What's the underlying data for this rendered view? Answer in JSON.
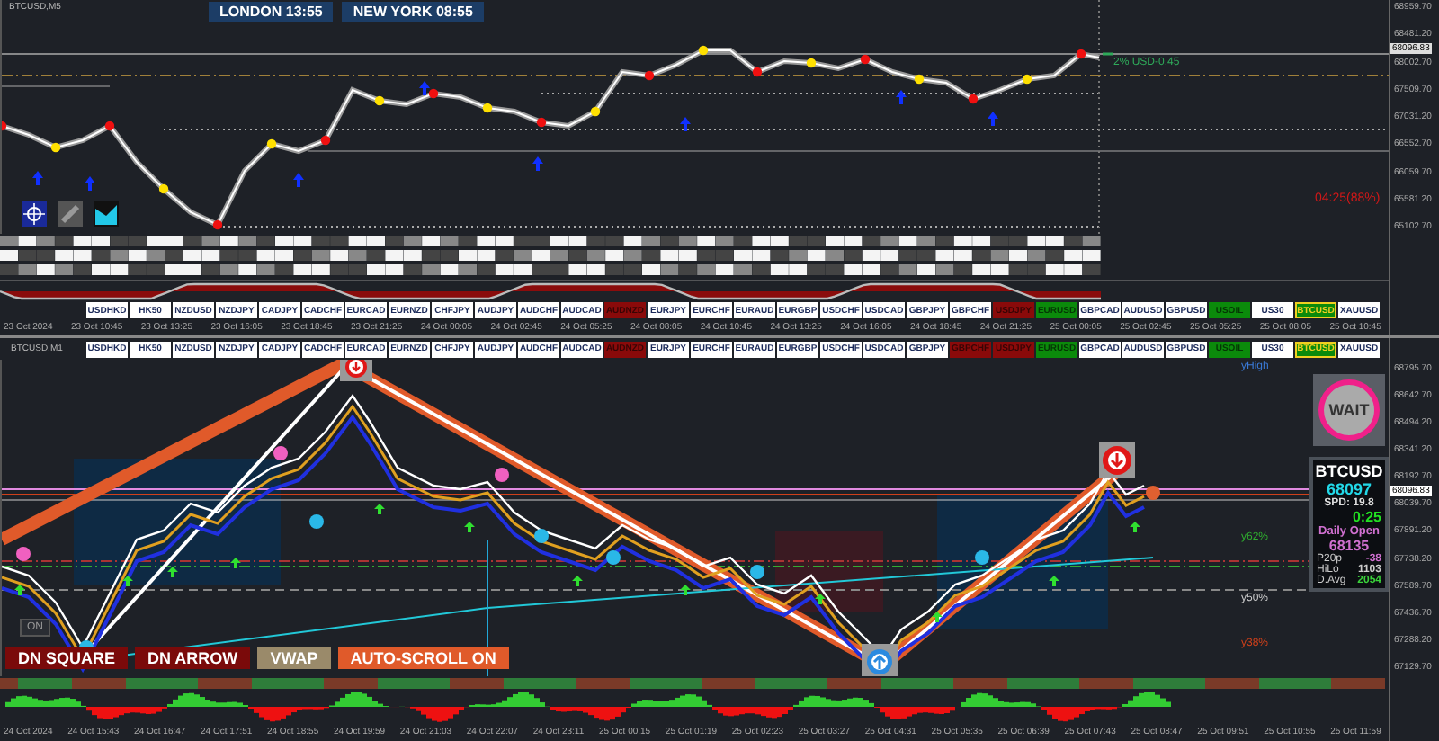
{
  "top_chart": {
    "title": "BTCUSD,M5",
    "sessions": [
      {
        "label": "LONDON 13:55"
      },
      {
        "label": "NEW YORK 08:55"
      }
    ],
    "risk_label": "2% USD-0.45",
    "timer": "04:25(88%)",
    "price_axis": [
      "68959.70",
      "68481.20",
      "68002.70",
      "67509.70",
      "67031.20",
      "66552.70",
      "66059.70",
      "65581.20",
      "65102.70"
    ],
    "current_price": "68096.83",
    "symbols": [
      {
        "label": "USDHKD",
        "color": "#ffffff",
        "selected": false
      },
      {
        "label": "HK50",
        "color": "#ffffff",
        "selected": false
      },
      {
        "label": "NZDUSD",
        "color": "#ffffff",
        "selected": false
      },
      {
        "label": "NZDJPY",
        "color": "#ffffff",
        "selected": false
      },
      {
        "label": "CADJPY",
        "color": "#ffffff",
        "selected": false
      },
      {
        "label": "CADCHF",
        "color": "#ffffff",
        "selected": false
      },
      {
        "label": "EURCAD",
        "color": "#ffffff",
        "selected": false
      },
      {
        "label": "EURNZD",
        "color": "#ffffff",
        "selected": false
      },
      {
        "label": "CHFJPY",
        "color": "#ffffff",
        "selected": false
      },
      {
        "label": "AUDJPY",
        "color": "#ffffff",
        "selected": false
      },
      {
        "label": "AUDCHF",
        "color": "#ffffff",
        "selected": false
      },
      {
        "label": "AUDCAD",
        "color": "#ffffff",
        "selected": false
      },
      {
        "label": "AUDNZD",
        "color": "#8a0a0a",
        "selected": false
      },
      {
        "label": "EURJPY",
        "color": "#ffffff",
        "selected": false
      },
      {
        "label": "EURCHF",
        "color": "#ffffff",
        "selected": false
      },
      {
        "label": "EURAUD",
        "color": "#ffffff",
        "selected": false
      },
      {
        "label": "EURGBP",
        "color": "#ffffff",
        "selected": false
      },
      {
        "label": "USDCHF",
        "color": "#ffffff",
        "selected": false
      },
      {
        "label": "USDCAD",
        "color": "#ffffff",
        "selected": false
      },
      {
        "label": "GBPJPY",
        "color": "#ffffff",
        "selected": false
      },
      {
        "label": "GBPCHF",
        "color": "#ffffff",
        "selected": false
      },
      {
        "label": "USDJPY",
        "color": "#8a0a0a",
        "selected": false
      },
      {
        "label": "EURUSD",
        "color": "#0b8a0b",
        "selected": false
      },
      {
        "label": "GBPCAD",
        "color": "#ffffff",
        "selected": false
      },
      {
        "label": "AUDUSD",
        "color": "#ffffff",
        "selected": false
      },
      {
        "label": "GBPUSD",
        "color": "#ffffff",
        "selected": false
      },
      {
        "label": "USOIL",
        "color": "#0b8a0b",
        "selected": false
      },
      {
        "label": "US30",
        "color": "#ffffff",
        "selected": false
      },
      {
        "label": "BTCUSD",
        "color": "#0b8a0b",
        "selected": true
      },
      {
        "label": "XAUUSD",
        "color": "#ffffff",
        "selected": false
      }
    ],
    "time_axis": [
      "23 Oct 2024",
      "23 Oct 10:45",
      "23 Oct 13:25",
      "23 Oct 16:05",
      "23 Oct 18:45",
      "23 Oct 21:25",
      "24 Oct 00:05",
      "24 Oct 02:45",
      "24 Oct 05:25",
      "24 Oct 08:05",
      "24 Oct 10:45",
      "24 Oct 13:25",
      "24 Oct 16:05",
      "24 Oct 18:45",
      "24 Oct 21:25",
      "25 Oct 00:05",
      "25 Oct 02:45",
      "25 Oct 05:25",
      "25 Oct 08:05",
      "25 Oct 10:45"
    ]
  },
  "bottom_chart": {
    "title": "BTCUSD,M1",
    "symbols": [
      {
        "label": "USDHKD",
        "color": "#ffffff",
        "selected": false
      },
      {
        "label": "HK50",
        "color": "#ffffff",
        "selected": false
      },
      {
        "label": "NZDUSD",
        "color": "#ffffff",
        "selected": false
      },
      {
        "label": "NZDJPY",
        "color": "#ffffff",
        "selected": false
      },
      {
        "label": "CADJPY",
        "color": "#ffffff",
        "selected": false
      },
      {
        "label": "CADCHF",
        "color": "#ffffff",
        "selected": false
      },
      {
        "label": "EURCAD",
        "color": "#ffffff",
        "selected": false
      },
      {
        "label": "EURNZD",
        "color": "#ffffff",
        "selected": false
      },
      {
        "label": "CHFJPY",
        "color": "#ffffff",
        "selected": false
      },
      {
        "label": "AUDJPY",
        "color": "#ffffff",
        "selected": false
      },
      {
        "label": "AUDCHF",
        "color": "#ffffff",
        "selected": false
      },
      {
        "label": "AUDCAD",
        "color": "#ffffff",
        "selected": false
      },
      {
        "label": "AUDNZD",
        "color": "#8a0a0a",
        "selected": false
      },
      {
        "label": "EURJPY",
        "color": "#ffffff",
        "selected": false
      },
      {
        "label": "EURCHF",
        "color": "#ffffff",
        "selected": false
      },
      {
        "label": "EURAUD",
        "color": "#ffffff",
        "selected": false
      },
      {
        "label": "EURGBP",
        "color": "#ffffff",
        "selected": false
      },
      {
        "label": "USDCHF",
        "color": "#ffffff",
        "selected": false
      },
      {
        "label": "USDCAD",
        "color": "#ffffff",
        "selected": false
      },
      {
        "label": "GBPJPY",
        "color": "#ffffff",
        "selected": false
      },
      {
        "label": "GBPCHF",
        "color": "#8a0a0a",
        "selected": false
      },
      {
        "label": "USDJPY",
        "color": "#8a0a0a",
        "selected": false
      },
      {
        "label": "EURUSD",
        "color": "#0b8a0b",
        "selected": false
      },
      {
        "label": "GBPCAD",
        "color": "#ffffff",
        "selected": false
      },
      {
        "label": "AUDUSD",
        "color": "#ffffff",
        "selected": false
      },
      {
        "label": "GBPUSD",
        "color": "#ffffff",
        "selected": false
      },
      {
        "label": "USOIL",
        "color": "#0b8a0b",
        "selected": false
      },
      {
        "label": "US30",
        "color": "#ffffff",
        "selected": false
      },
      {
        "label": "BTCUSD",
        "color": "#0b8a0b",
        "selected": true
      },
      {
        "label": "XAUUSD",
        "color": "#ffffff",
        "selected": false
      }
    ],
    "level_labels": [
      {
        "label": "yHigh",
        "kind": "high"
      },
      {
        "label": "y62%",
        "kind": "upper"
      },
      {
        "label": "y50%",
        "kind": "middle"
      },
      {
        "label": "y38%",
        "kind": "lower"
      }
    ],
    "toggle": "ON",
    "buttons": [
      {
        "label": "DN SQUARE",
        "kind": "alert"
      },
      {
        "label": "DN ARROW",
        "kind": "alert"
      },
      {
        "label": "VWAP",
        "kind": "muted"
      },
      {
        "label": "AUTO-SCROLL ON",
        "kind": "accent"
      }
    ],
    "signal": "WAIT",
    "info": {
      "symbol": "BTCUSD",
      "price": "68097",
      "spread": "SPD: 19.8",
      "countdown": "0:25",
      "daily_open_label": "Daily Open",
      "daily_open": "68135",
      "stats": [
        {
          "label": "P20p",
          "value": "-38",
          "kind": "negative"
        },
        {
          "label": "HiLo",
          "value": "1103",
          "kind": "neutral"
        },
        {
          "label": "D.Avg",
          "value": "2054",
          "kind": "positive"
        }
      ]
    },
    "price_axis": [
      "68795.70",
      "68642.70",
      "68494.20",
      "68341.20",
      "68192.70",
      "68039.70",
      "67891.20",
      "67738.20",
      "67589.70",
      "67436.70",
      "67288.20",
      "67129.70"
    ],
    "current_price": "68096.83",
    "time_axis": [
      "24 Oct 2024",
      "24 Oct 15:43",
      "24 Oct 16:47",
      "24 Oct 17:51",
      "24 Oct 18:55",
      "24 Oct 19:59",
      "24 Oct 21:03",
      "24 Oct 22:07",
      "24 Oct 23:11",
      "25 Oct 00:15",
      "25 Oct 01:19",
      "25 Oct 02:23",
      "25 Oct 03:27",
      "25 Oct 04:31",
      "25 Oct 05:35",
      "25 Oct 06:39",
      "25 Oct 07:43",
      "25 Oct 08:47",
      "25 Oct 09:51",
      "25 Oct 10:55",
      "25 Oct 11:59"
    ]
  }
}
